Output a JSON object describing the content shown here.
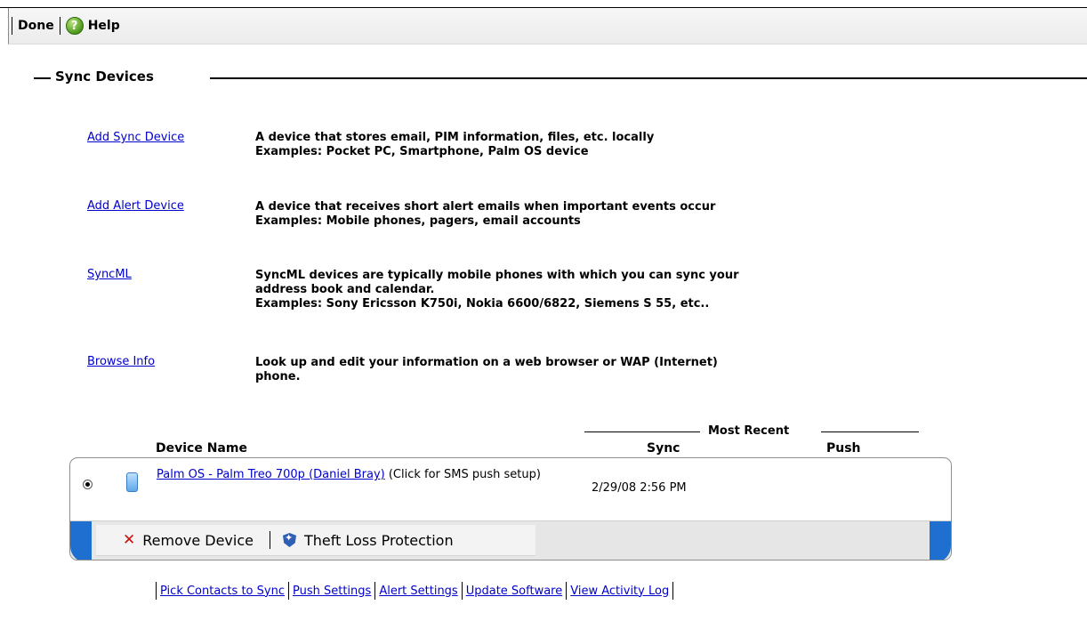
{
  "toolbar": {
    "done_label": "Done",
    "help_label": "Help",
    "help_icon_glyph": "?"
  },
  "section": {
    "title": "Sync Devices"
  },
  "options": [
    {
      "link": "Add Sync Device",
      "desc_line1": "A device that stores email, PIM information, files, etc. locally",
      "desc_line2": "Examples: Pocket PC, Smartphone, Palm OS device"
    },
    {
      "link": "Add Alert Device",
      "desc_line1": "A device that receives short alert emails when important events occur",
      "desc_line2": "Examples: Mobile phones, pagers, email accounts"
    },
    {
      "link": "SyncML",
      "desc_line1": "SyncML devices are typically mobile phones with which you can sync your",
      "desc_line2": "address book and calendar.",
      "desc_line3": "Examples: Sony Ericsson K750i, Nokia 6600/6822, Siemens S 55, etc.."
    },
    {
      "link": "Browse Info",
      "desc_line1": "Look up and edit your information on a web browser or WAP (Internet)",
      "desc_line2": "phone."
    }
  ],
  "table": {
    "most_recent_label": "Most Recent",
    "col_device_name": "Device Name",
    "col_sync": "Sync",
    "col_push": "Push",
    "device": {
      "name_link": "Palm OS - Palm Treo 700p (Daniel Bray)",
      "name_suffix": " (Click for SMS push setup)",
      "sync": "2/29/08 2:56 PM",
      "push": ""
    }
  },
  "actions": {
    "remove_label": "Remove Device",
    "theft_label": "Theft Loss Protection"
  },
  "footer": {
    "links": [
      "Pick Contacts to Sync",
      "Push Settings",
      "Alert Settings",
      "Update Software",
      "View Activity Log"
    ]
  },
  "colors": {
    "link": "#0000cc",
    "accent_blue": "#1e6fd0",
    "remove_red": "#cc1111"
  }
}
